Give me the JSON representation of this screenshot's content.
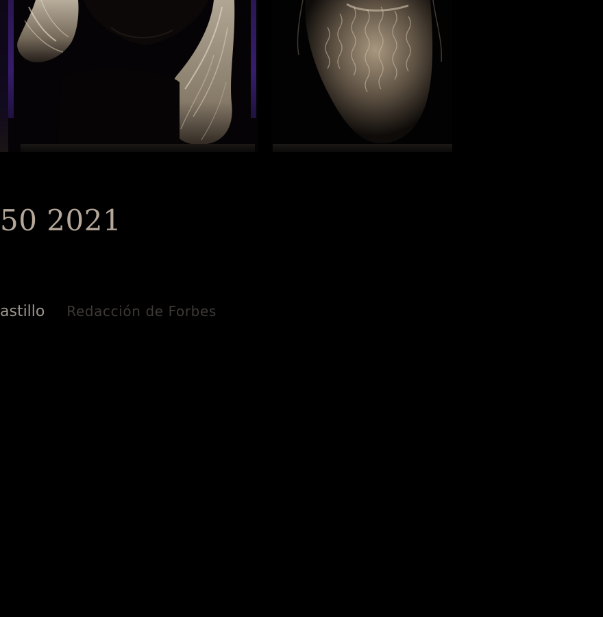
{
  "article": {
    "headline": "50 2021",
    "author": "astillo",
    "credit": "Redacción de Forbes"
  },
  "images": [
    {
      "name": "portrait-long-hair",
      "tone": "#c9bba8"
    },
    {
      "name": "portrait-beard",
      "tone": "#b9a892"
    }
  ],
  "colors": {
    "background": "#000000",
    "headline": "#b5a89a",
    "author": "#9c958c",
    "credit": "#3d3935",
    "accent_purple": "#361d6c"
  }
}
